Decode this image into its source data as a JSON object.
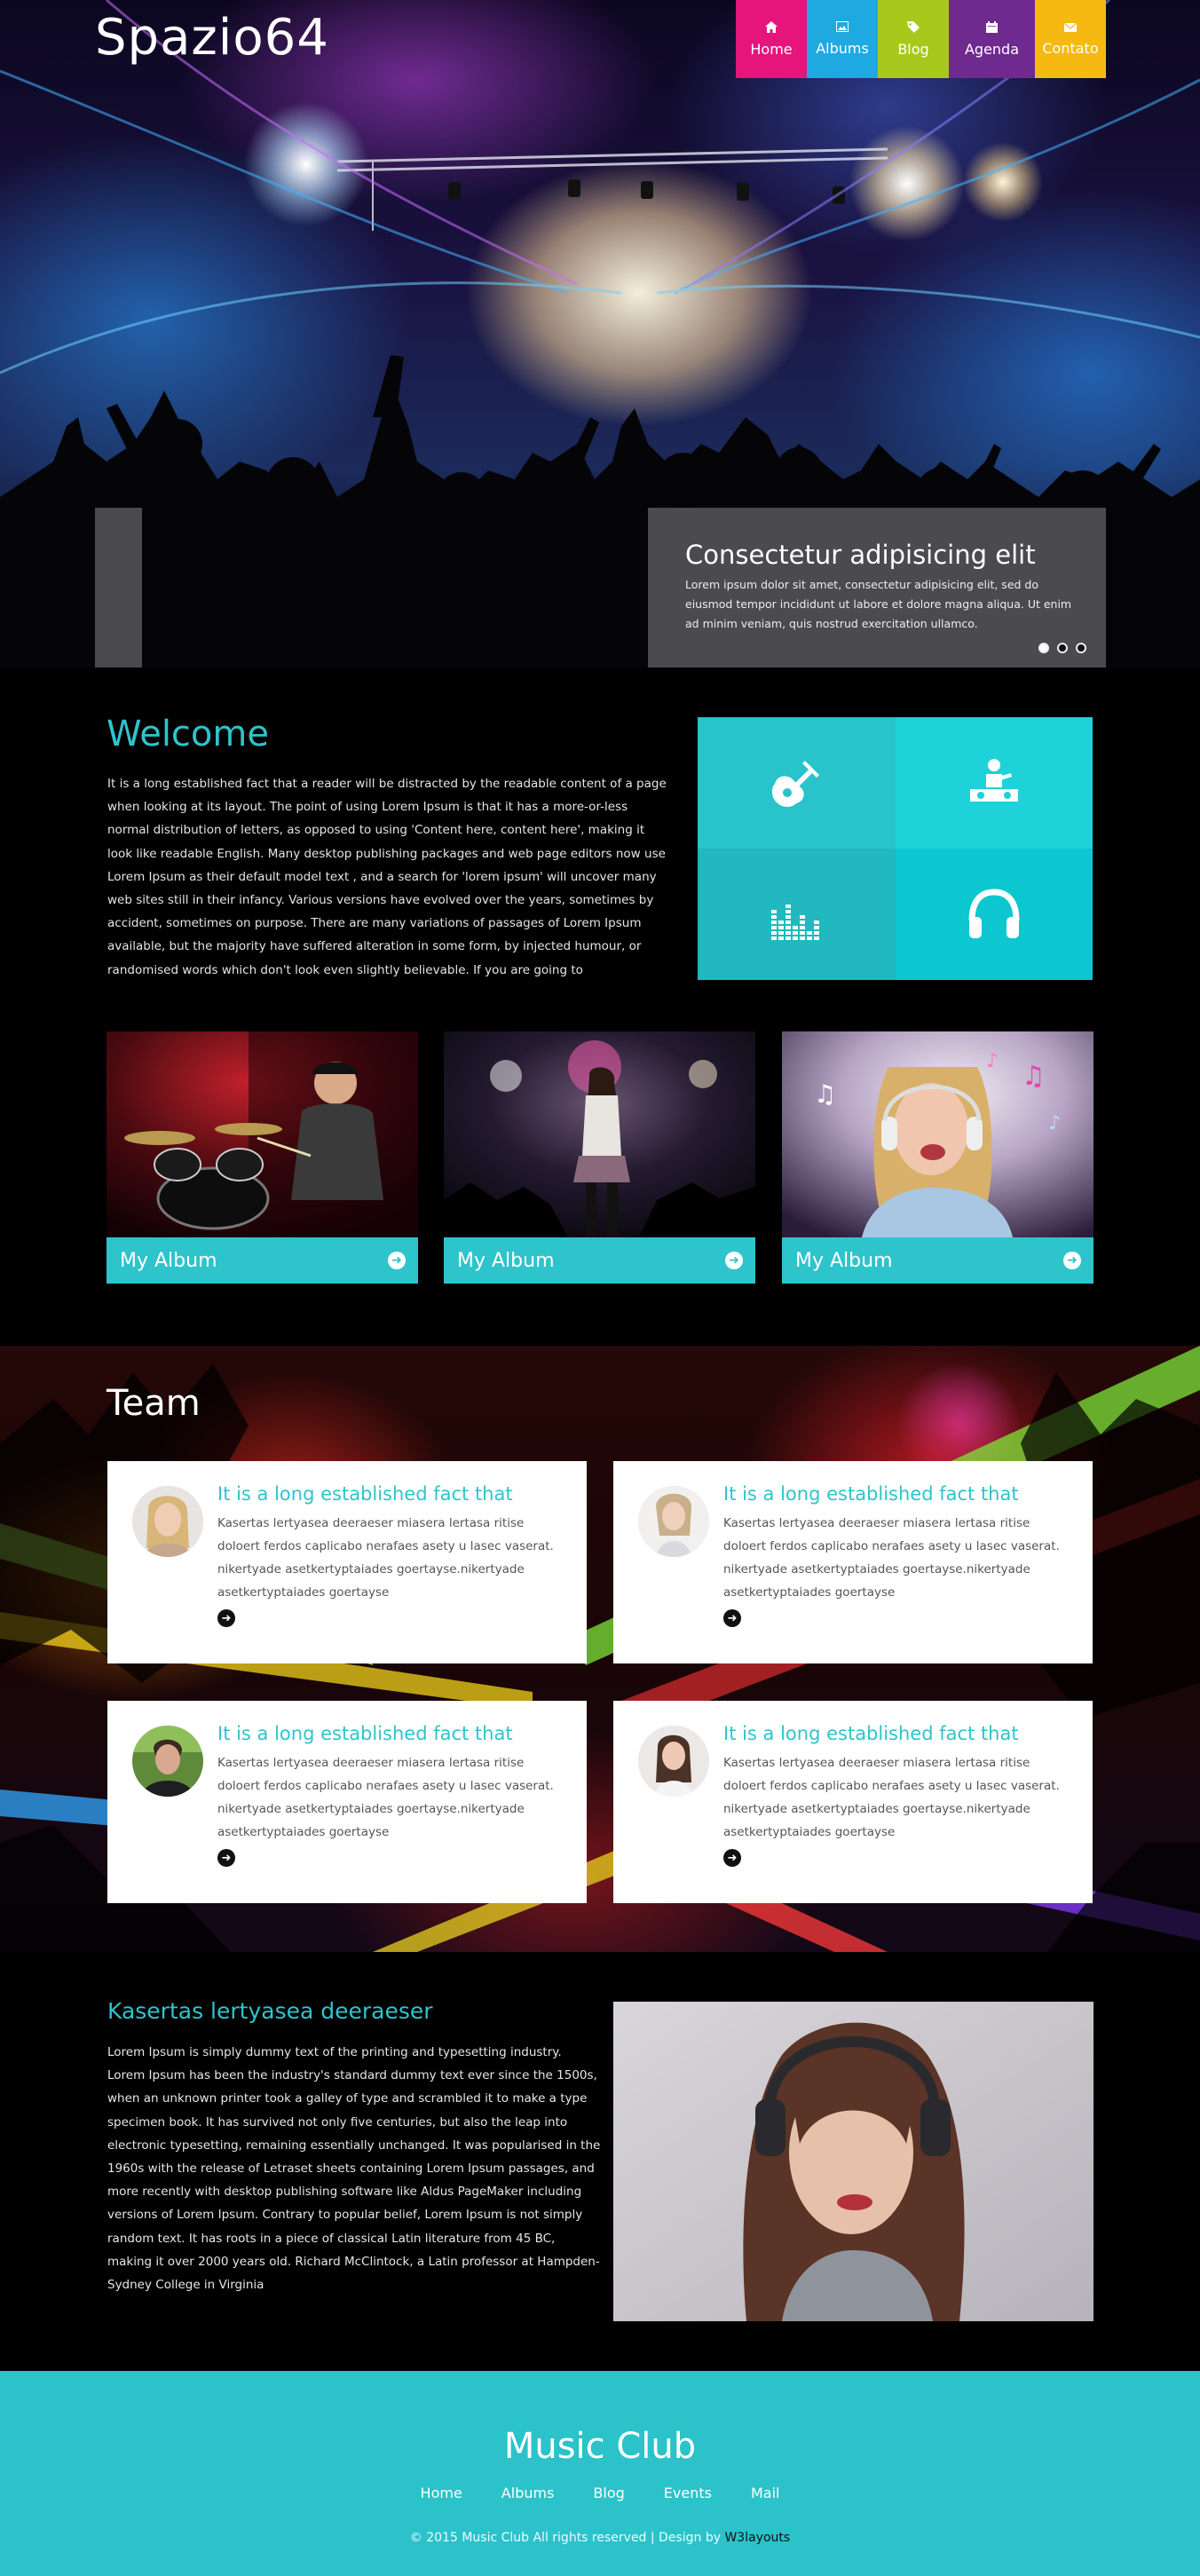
{
  "header": {
    "logo": "Spazio64",
    "nav": [
      {
        "label": "Home",
        "icon": "home-icon",
        "color": "#e5157c"
      },
      {
        "label": "Albums",
        "icon": "image-icon",
        "color": "#1ea9e1"
      },
      {
        "label": "Blog",
        "icon": "tag-icon",
        "color": "#a8c81c"
      },
      {
        "label": "Agenda",
        "icon": "calendar-icon",
        "color": "#6f2a8f"
      },
      {
        "label": "Contato",
        "icon": "envelope-icon",
        "color": "#f6b911"
      }
    ]
  },
  "slider": {
    "title": "Consectetur adipisicing elit",
    "text": "Lorem ipsum dolor sit amet, consectetur adipisicing elit, sed do eiusmod tempor incididunt ut labore et dolore magna aliqua. Ut enim ad minim veniam, quis nostrud exercitation ullamco.",
    "slides": 3,
    "active_slide": 1
  },
  "welcome": {
    "title": "Welcome",
    "text": "It is a long established fact that a reader will be distracted by the readable content of a page when looking at its layout. The point of using Lorem Ipsum is that it has a more-or-less normal distribution of letters, as opposed to using 'Content here, content here', making it look like readable English. Many desktop publishing packages and web page editors now use Lorem Ipsum as their default model text , and a search for 'lorem ipsum' will uncover many web sites still in their infancy. Various versions have evolved over the years, sometimes by accident, sometimes on purpose. There are many variations of passages of Lorem Ipsum available, but the majority have suffered alteration in some form, by injected humour, or randomised words which don't look even slightly believable. If you are going to",
    "tiles": [
      "guitar-icon",
      "dj-icon",
      "equalizer-icon",
      "headphones-icon"
    ],
    "accent": "#2ec4cc"
  },
  "albums": [
    {
      "label": "My Album"
    },
    {
      "label": "My Album"
    },
    {
      "label": "My Album"
    }
  ],
  "team": {
    "title": "Team",
    "members": [
      {
        "heading": "It is a long established fact that",
        "text": "Kasertas lertyasea deeraeser miasera lertasa ritise doloert ferdos caplicabo nerafaes asety u lasec vaserat. nikertyade asetkertyptaiades goertayse.nikertyade asetkertyptaiades goertayse"
      },
      {
        "heading": "It is a long established fact that",
        "text": "Kasertas lertyasea deeraeser miasera lertasa ritise doloert ferdos caplicabo nerafaes asety u lasec vaserat. nikertyade asetkertyptaiades goertayse.nikertyade asetkertyptaiades goertayse"
      },
      {
        "heading": "It is a long established fact that",
        "text": "Kasertas lertyasea deeraeser miasera lertasa ritise doloert ferdos caplicabo nerafaes asety u lasec vaserat. nikertyade asetkertyptaiades goertayse.nikertyade asetkertyptaiades goertayse"
      },
      {
        "heading": "It is a long established fact that",
        "text": "Kasertas lertyasea deeraeser miasera lertasa ritise doloert ferdos caplicabo nerafaes asety u lasec vaserat. nikertyade asetkertyptaiades goertayse.nikertyade asetkertyptaiades goertayse"
      }
    ]
  },
  "about": {
    "title": "Kasertas lertyasea deeraeser",
    "text": "Lorem Ipsum is simply dummy text of the printing and typesetting industry. Lorem Ipsum has been the industry's standard dummy text ever since the 1500s, when an unknown printer took a galley of type and scrambled it to make a type specimen book. It has survived not only five centuries, but also the leap into electronic typesetting, remaining essentially unchanged. It was popularised in the 1960s with the release of Letraset sheets containing Lorem Ipsum passages, and more recently with desktop publishing software like Aldus PageMaker including versions of Lorem Ipsum. Contrary to popular belief, Lorem Ipsum is not simply random text. It has roots in a piece of classical Latin literature from 45 BC, making it over 2000 years old. Richard McClintock, a Latin professor at Hampden-Sydney College in Virginia"
  },
  "footer": {
    "title": "Music Club",
    "nav": [
      "Home",
      "Albums",
      "Blog",
      "Events",
      "Mail"
    ],
    "copyright": "© 2015 Music Club All rights reserved | Design by ",
    "credit": "W3layouts",
    "bg": "#2cc2ca"
  }
}
